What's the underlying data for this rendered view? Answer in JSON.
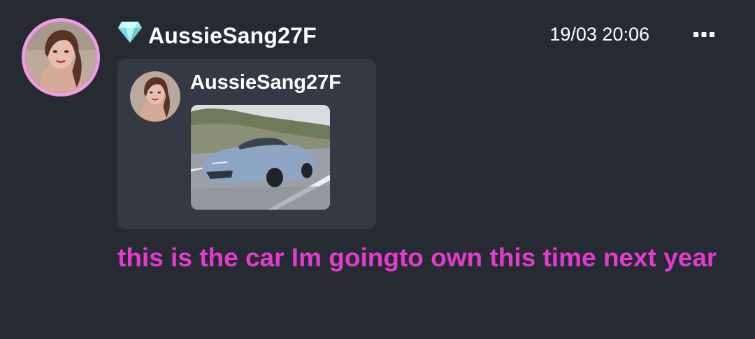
{
  "post": {
    "username": "AussieSang27F",
    "timestamp": "19/03 20:06",
    "badge_icon": "diamond-icon",
    "menu_icon": "more-options-icon",
    "message": "this is the car Im goingto own this time next year"
  },
  "quote": {
    "username": "AussieSang27F",
    "image_subject": "car-photo"
  },
  "colors": {
    "background": "#262a33",
    "card": "#343943",
    "avatar_ring": "#f09be6",
    "message_text": "#e23ccc",
    "badge": "#9be8ee"
  }
}
